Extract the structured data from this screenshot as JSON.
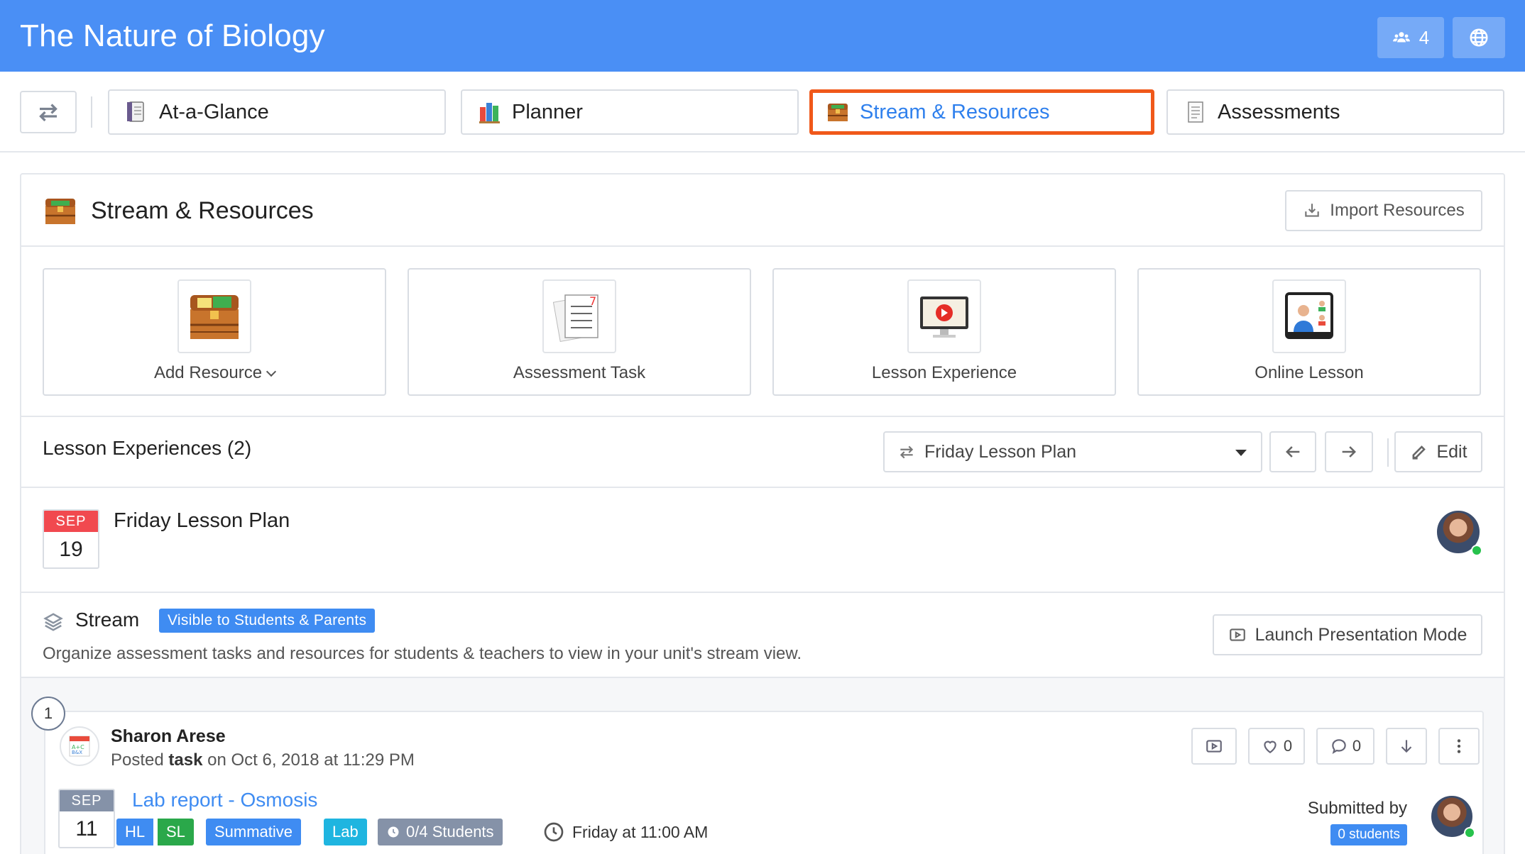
{
  "header": {
    "title": "The Nature of Biology",
    "members_count": "4"
  },
  "tabs": [
    {
      "label": "At-a-Glance"
    },
    {
      "label": "Planner"
    },
    {
      "label": "Stream & Resources",
      "active": true
    },
    {
      "label": "Assessments"
    }
  ],
  "section": {
    "title": "Stream & Resources",
    "import_label": "Import Resources"
  },
  "tiles": [
    {
      "label": "Add Resource"
    },
    {
      "label": "Assessment Task"
    },
    {
      "label": "Lesson Experience"
    },
    {
      "label": "Online Lesson"
    }
  ],
  "lesson_experiences": {
    "title": "Lesson Experiences (2)",
    "selected": "Friday Lesson Plan",
    "edit_label": "Edit"
  },
  "lesson": {
    "month": "SEP",
    "day": "19",
    "name": "Friday Lesson Plan"
  },
  "stream": {
    "label": "Stream",
    "visibility": "Visible to Students & Parents",
    "description": "Organize assessment tasks and resources for students & teachers to view in your unit's stream view.",
    "present_label": "Launch Presentation Mode"
  },
  "post": {
    "number": "1",
    "author": "Sharon Arese",
    "posted_prefix": "Posted",
    "posted_type": "task",
    "posted_suffix": "on Oct 6, 2018 at 11:29 PM",
    "likes": "0",
    "comments": "0",
    "task": {
      "month": "SEP",
      "day": "11",
      "title": "Lab report - Osmosis",
      "tags": [
        "HL",
        "SL",
        "Summative",
        "Lab",
        "0/4 Students"
      ],
      "due": "Friday at 11:00 AM",
      "submitted_label": "Submitted by",
      "submitted_count": "0 students"
    }
  },
  "colors": {
    "header": "#4a8ff5",
    "accent": "#3f8cf2",
    "active_border": "#f0581a",
    "calendar_red": "#f1494f",
    "calendar_gray": "#8592a8",
    "tag_green": "#2aa84a",
    "tag_cyan": "#1fb5e0",
    "tag_gray": "#8592a8"
  }
}
